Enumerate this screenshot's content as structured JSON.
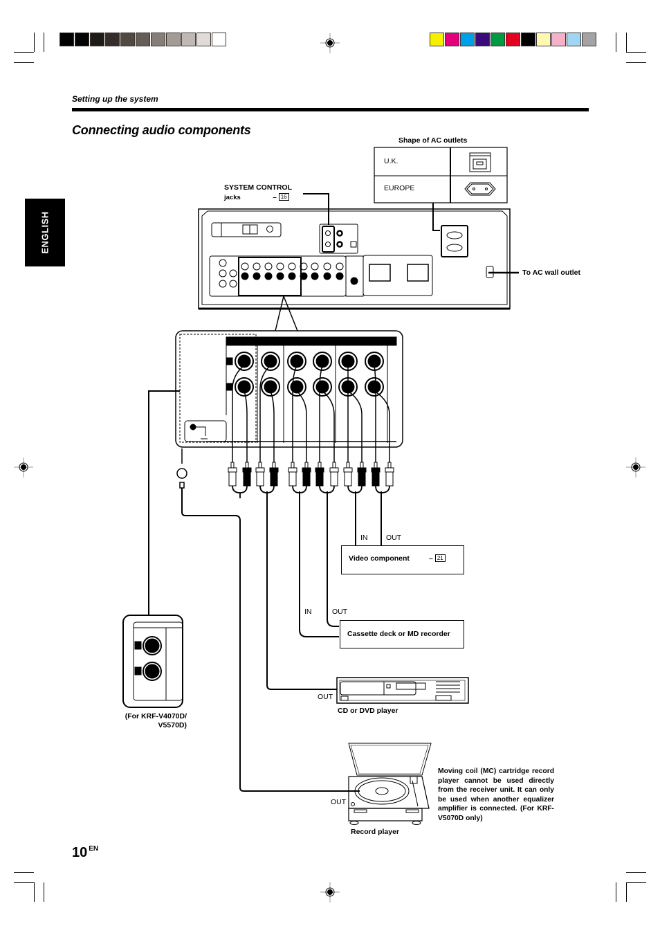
{
  "print_marks": {
    "grayscale_swatches": [
      "#000000",
      "#040304",
      "#1e1a18",
      "#342d2b",
      "#514842",
      "#675d58",
      "#877d78",
      "#a59b96",
      "#c2b8b3",
      "#e0dbd8",
      "#ffffff"
    ],
    "color_swatches": [
      "#f6f000",
      "#e4007c",
      "#00a0e8",
      "#390a7b",
      "#009944",
      "#e60020",
      "#000000",
      "#fff9b2",
      "#f5b1c8",
      "#9fd6f3",
      "#a4a4a4"
    ]
  },
  "header": {
    "section_label": "Setting up the system",
    "page_title": "Connecting audio components",
    "language_tab": "ENGLISH"
  },
  "ac_outlets": {
    "title": "Shape of AC outlets",
    "rows": [
      {
        "region": "U.K.",
        "icon": "uk-outlet-icon"
      },
      {
        "region": "EUROPE",
        "icon": "europe-outlet-icon"
      }
    ]
  },
  "callouts": {
    "system_control": "SYSTEM CONTROL",
    "system_control_sub": "jacks",
    "system_control_ref": "16",
    "ac_wall_outlet": "To AC wall outlet"
  },
  "components": {
    "video": {
      "label": "Video component",
      "ref": "21",
      "in": "IN",
      "out": "OUT"
    },
    "cassette": {
      "label": "Cassette deck or MD recorder",
      "in": "IN",
      "out": "OUT"
    },
    "cd": {
      "label": "CD or DVD player",
      "out": "OUT"
    },
    "record": {
      "label": "Record player",
      "out": "OUT"
    }
  },
  "inset_note": "(For KRF-V4070D/\nV5570D)",
  "inset_note_line1": "(For KRF-V4070D/",
  "inset_note_line2": "V5570D)",
  "mc_note": "Moving coil (MC) cartridge record player cannot be used directly from the receiver unit. It can only be used when another equalizer amplifier is connected. (For KRF-V5070D only)",
  "footer": {
    "page_number": "10",
    "page_suffix": "EN"
  }
}
